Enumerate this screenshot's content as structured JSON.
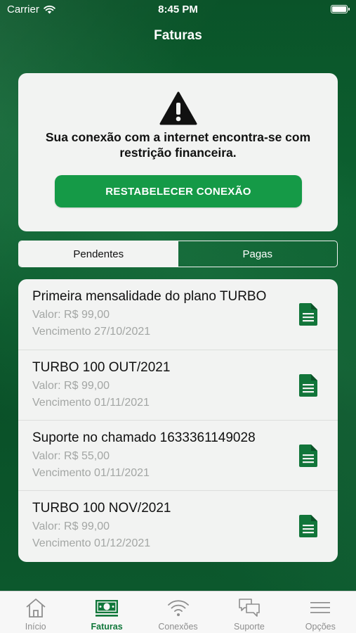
{
  "status_bar": {
    "carrier": "Carrier",
    "time": "8:45 PM"
  },
  "header": {
    "title": "Faturas"
  },
  "alert": {
    "message": "Sua conexão com a internet encontra-se com restrição financeira.",
    "button_label": "RESTABELECER CONEXÃO",
    "icon": "warning-icon"
  },
  "tabs": {
    "pending": "Pendentes",
    "paid": "Pagas",
    "selected": "Pendentes"
  },
  "invoices": [
    {
      "title": "Primeira mensalidade do plano TURBO",
      "value": "Valor: R$ 99,00",
      "due": "Vencimento 27/10/2021"
    },
    {
      "title": "TURBO 100 OUT/2021",
      "value": "Valor: R$ 99,00",
      "due": "Vencimento 01/11/2021"
    },
    {
      "title": "Suporte no chamado 1633361149028",
      "value": "Valor: R$ 55,00",
      "due": "Vencimento 01/11/2021"
    },
    {
      "title": "TURBO 100 NOV/2021",
      "value": "Valor: R$ 99,00",
      "due": "Vencimento 01/12/2021"
    }
  ],
  "tabbar": {
    "items": [
      {
        "label": "Início",
        "icon": "home-icon"
      },
      {
        "label": "Faturas",
        "icon": "money-icon",
        "active": true
      },
      {
        "label": "Conexões",
        "icon": "wifi-icon"
      },
      {
        "label": "Suporte",
        "icon": "chat-icon"
      },
      {
        "label": "Opções",
        "icon": "menu-icon"
      }
    ]
  },
  "colors": {
    "brand_green": "#159a47",
    "active_tab": "#10773a",
    "document_icon": "#12753a",
    "background": "#0c5a2e"
  }
}
